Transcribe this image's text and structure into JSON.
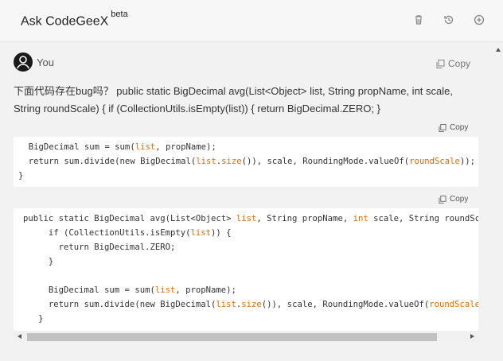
{
  "header": {
    "title": "Ask CodeGeeX",
    "badge": "beta",
    "icons": [
      "trash-icon",
      "history-icon",
      "add-icon"
    ]
  },
  "message": {
    "author": "You",
    "copy_label": "Copy",
    "question": "下面代码存在bug吗？  public static BigDecimal avg(List<Object> list, String propName, int scale, String roundScale) { if (CollectionUtils.isEmpty(list)) { return BigDecimal.ZERO; }"
  },
  "code_block_1": {
    "copy_label": "Copy",
    "lines": [
      "  BigDecimal sum = sum(list, propName);",
      "  return sum.divide(new BigDecimal(list.size()), scale, RoundingMode.valueOf(roundScale));",
      "}"
    ]
  },
  "code_block_2": {
    "copy_label": "Copy",
    "lines": [
      "public static BigDecimal avg(List<Object> list, String propName, int scale, String roundSca",
      "     if (CollectionUtils.isEmpty(list)) {",
      "       return BigDecimal.ZERO;",
      "     }",
      "",
      "     BigDecimal sum = sum(list, propName);",
      "     return sum.divide(new BigDecimal(list.size()), scale, RoundingMode.valueOf(roundScale)",
      "   }"
    ]
  },
  "colors": {
    "highlight": "#e06c00",
    "background": "#f2f2f2",
    "code_background": "#ffffff"
  }
}
